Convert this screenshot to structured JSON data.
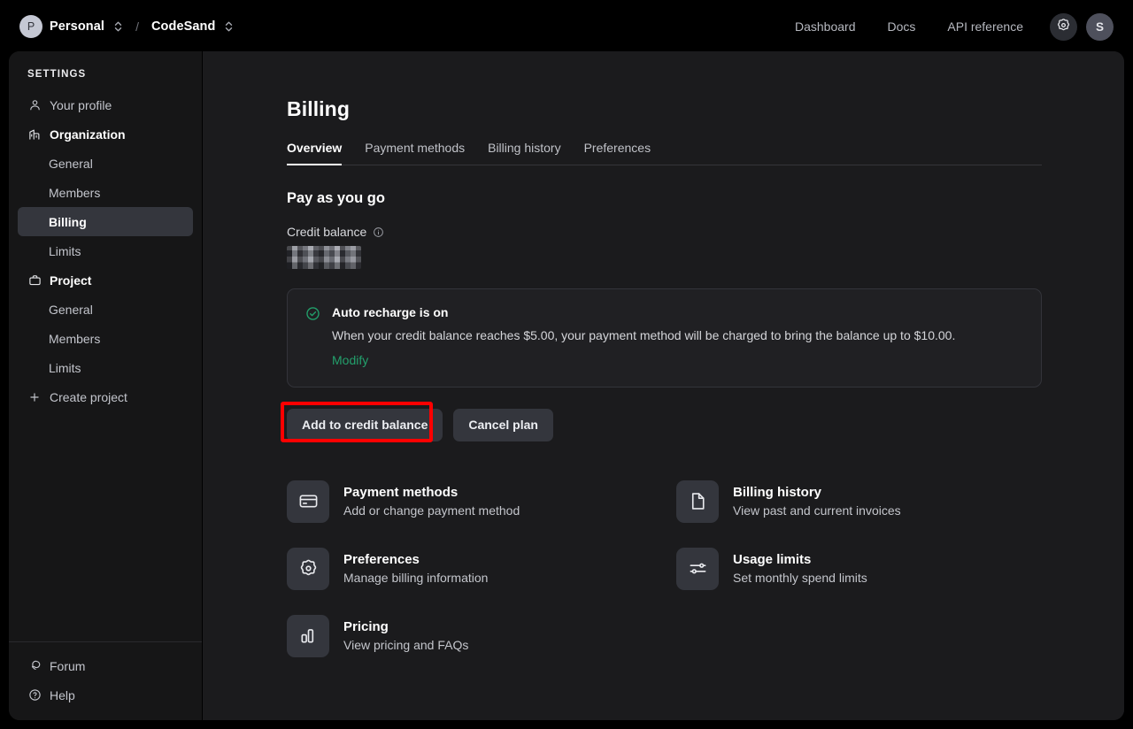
{
  "topbar": {
    "org_initial": "P",
    "org_name": "Personal",
    "separator": "/",
    "project_name": "CodeSand",
    "nav": [
      {
        "label": "Dashboard"
      },
      {
        "label": "Docs"
      },
      {
        "label": "API reference"
      }
    ],
    "settings_icon": "gear-icon",
    "user_initial": "S"
  },
  "sidebar": {
    "heading": "SETTINGS",
    "items": [
      {
        "label": "Your profile",
        "icon": "user-icon",
        "level": "top",
        "active": false
      },
      {
        "label": "Organization",
        "icon": "building-icon",
        "level": "group",
        "active": false
      },
      {
        "label": "General",
        "icon": "",
        "level": "sub",
        "active": false
      },
      {
        "label": "Members",
        "icon": "",
        "level": "sub",
        "active": false
      },
      {
        "label": "Billing",
        "icon": "",
        "level": "sub",
        "active": true
      },
      {
        "label": "Limits",
        "icon": "",
        "level": "sub",
        "active": false
      },
      {
        "label": "Project",
        "icon": "briefcase-icon",
        "level": "group",
        "active": false
      },
      {
        "label": "General",
        "icon": "",
        "level": "sub",
        "active": false
      },
      {
        "label": "Members",
        "icon": "",
        "level": "sub",
        "active": false
      },
      {
        "label": "Limits",
        "icon": "",
        "level": "sub",
        "active": false
      },
      {
        "label": "Create project",
        "icon": "plus-icon",
        "level": "create",
        "active": false
      }
    ],
    "footer": [
      {
        "label": "Forum",
        "icon": "chat-bubble-icon"
      },
      {
        "label": "Help",
        "icon": "question-circle-icon"
      }
    ]
  },
  "main": {
    "title": "Billing",
    "tabs": [
      {
        "label": "Overview",
        "active": true
      },
      {
        "label": "Payment methods",
        "active": false
      },
      {
        "label": "Billing history",
        "active": false
      },
      {
        "label": "Preferences",
        "active": false
      }
    ],
    "section_title": "Pay as you go",
    "credit_balance_label": "Credit balance",
    "credit_balance_info_icon": "info-icon",
    "credit_balance_value": "",
    "credit_balance_redacted": true,
    "recharge": {
      "status_icon": "check-circle-icon",
      "title": "Auto recharge is on",
      "description": "When your credit balance reaches $5.00, your payment method will be charged to bring the balance up to $10.00.",
      "modify_label": "Modify",
      "threshold": "$5.00",
      "top_up_to": "$10.00",
      "accent_color": "#23a06c"
    },
    "buttons": [
      {
        "label": "Add to credit balance",
        "highlighted": true
      },
      {
        "label": "Cancel plan",
        "highlighted": false
      }
    ],
    "highlight_color": "#ff0000",
    "cards": [
      {
        "title": "Payment methods",
        "subtitle": "Add or change payment method",
        "icon": "credit-card-icon"
      },
      {
        "title": "Billing history",
        "subtitle": "View past and current invoices",
        "icon": "document-icon"
      },
      {
        "title": "Preferences",
        "subtitle": "Manage billing information",
        "icon": "gear-icon"
      },
      {
        "title": "Usage limits",
        "subtitle": "Set monthly spend limits",
        "icon": "sliders-icon"
      },
      {
        "title": "Pricing",
        "subtitle": "View pricing and FAQs",
        "icon": "bar-chart-icon"
      }
    ]
  }
}
